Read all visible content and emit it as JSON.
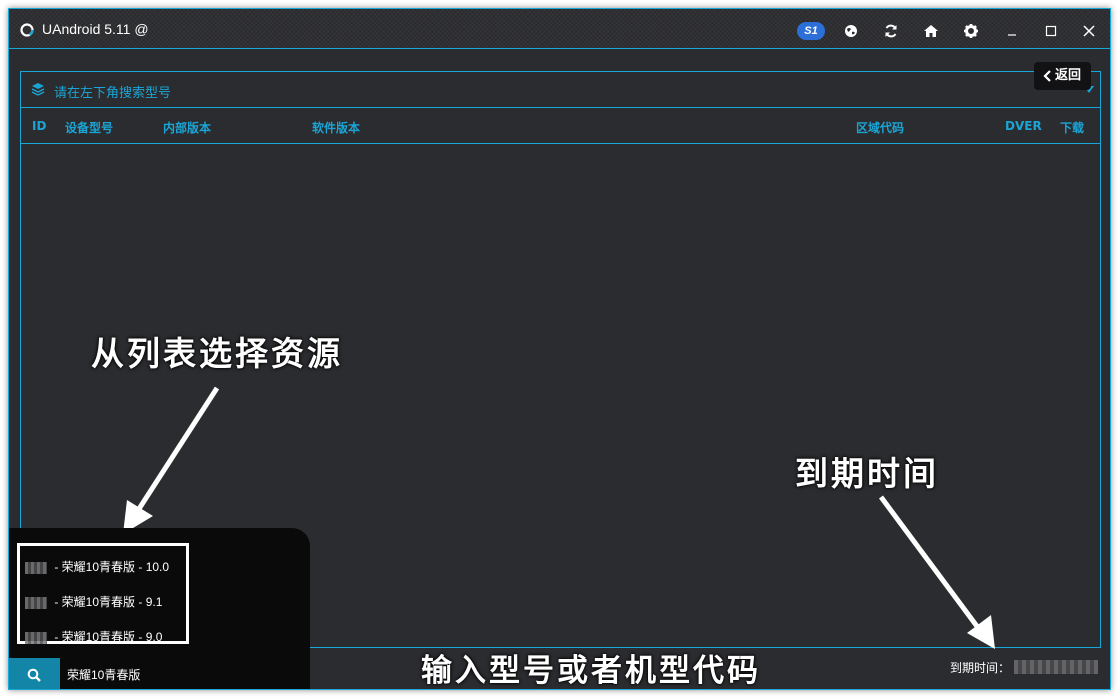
{
  "app": {
    "title": "UAndroid 5.11 @",
    "badge": "S1",
    "accent_color": "#17a7d8",
    "toolbar_icons": [
      "globe-icon",
      "refresh-icon",
      "home-icon",
      "gear-icon"
    ],
    "window_controls": [
      "minimize-icon",
      "maximize-icon",
      "close-icon"
    ]
  },
  "panel": {
    "hint": "请在左下角搜索型号",
    "back_label": "返回",
    "columns": [
      "ID",
      "设备型号",
      "内部版本",
      "软件版本",
      "区域代码",
      "DVER",
      "下载"
    ]
  },
  "annotations": {
    "select_list": "从列表选择资源",
    "expiry": "到期时间",
    "input_hint": "输入型号或者机型代码"
  },
  "dropdown": {
    "items": [
      {
        "separator": " - ",
        "name": "荣耀10青春版",
        "version": "10.0"
      },
      {
        "separator": " - ",
        "name": "荣耀10青春版",
        "version": "9.1"
      },
      {
        "separator": " - ",
        "name": "荣耀10青春版",
        "version": "9.0"
      }
    ]
  },
  "search": {
    "value": "荣耀10青春版"
  },
  "status": {
    "expiry_label": "到期时间："
  }
}
